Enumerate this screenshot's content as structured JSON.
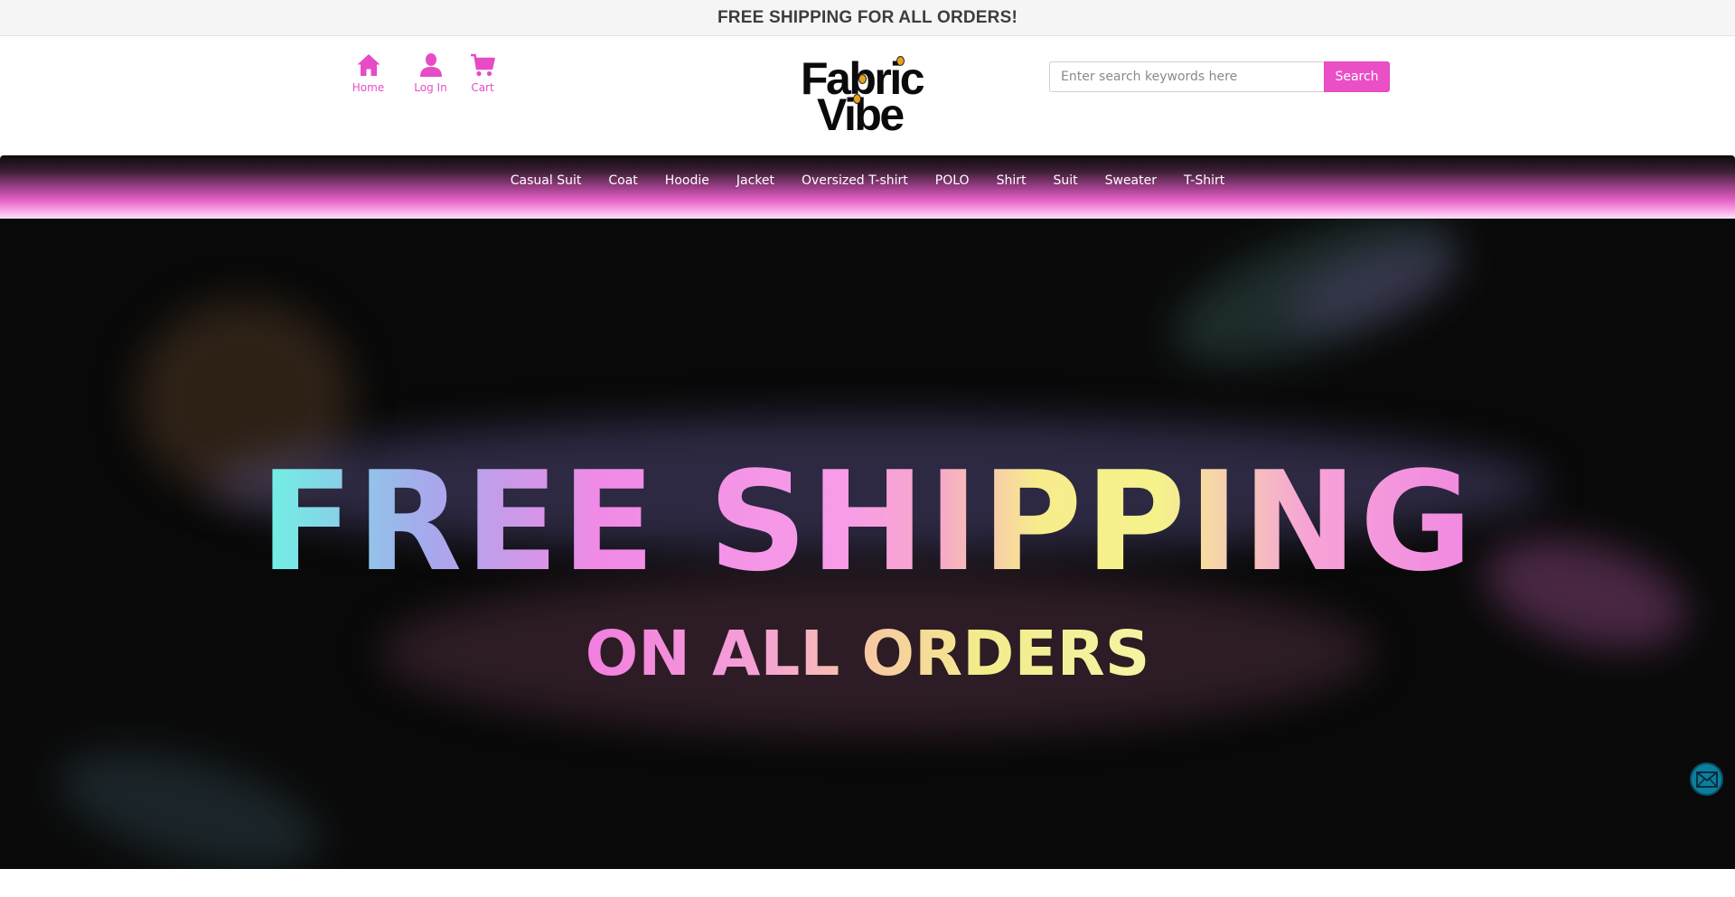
{
  "announcement": {
    "text": "FREE SHIPPING FOR ALL ORDERS!"
  },
  "header": {
    "quick_nav": [
      {
        "label": "Home",
        "icon": "home-icon"
      },
      {
        "label": "Log In",
        "icon": "user-icon"
      },
      {
        "label": "Cart",
        "icon": "cart-icon"
      }
    ],
    "logo": {
      "line1": "Fabric",
      "line2": "Vibe"
    },
    "search": {
      "placeholder": "Enter search keywords here",
      "button_label": "Search"
    }
  },
  "categories": [
    {
      "label": "Casual Suit"
    },
    {
      "label": "Coat"
    },
    {
      "label": "Hoodie"
    },
    {
      "label": "Jacket"
    },
    {
      "label": "Oversized T-shirt"
    },
    {
      "label": "POLO"
    },
    {
      "label": "Shirt"
    },
    {
      "label": "Suit"
    },
    {
      "label": "Sweater"
    },
    {
      "label": "T-Shirt"
    }
  ],
  "hero": {
    "title": "FREE SHIPPING",
    "subtitle": "ON ALL ORDERS"
  },
  "contact": {
    "icon": "mail-icon"
  },
  "colors": {
    "accent": "#ea4fc6",
    "announcement_bg": "#f5f5f5",
    "hero_bg": "#090909",
    "mail_button": "#0c7e9e"
  }
}
